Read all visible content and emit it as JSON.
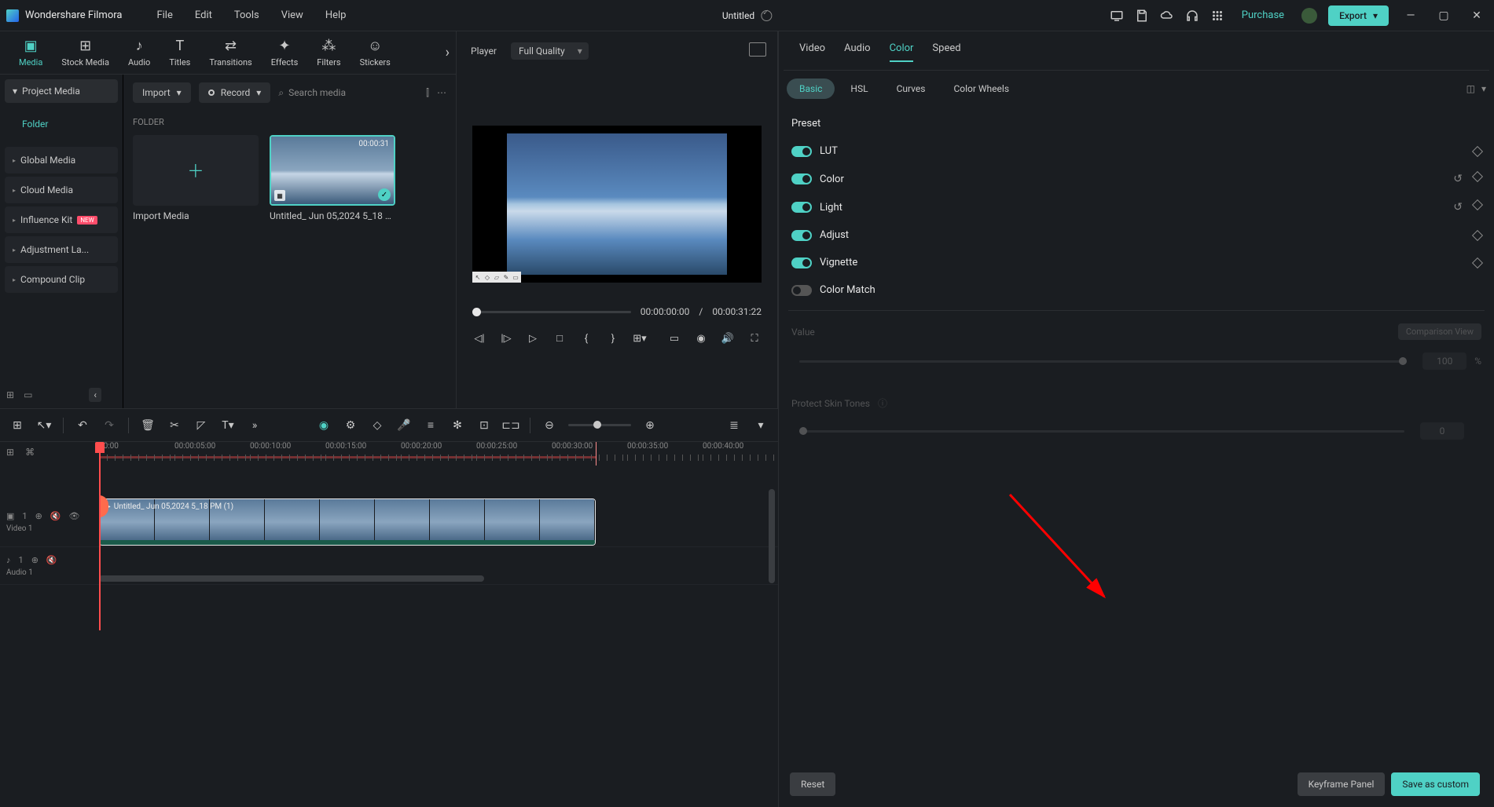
{
  "app": {
    "name": "Wondershare Filmora",
    "title": "Untitled"
  },
  "menu": [
    "File",
    "Edit",
    "Tools",
    "View",
    "Help"
  ],
  "titlebar": {
    "purchase": "Purchase",
    "export": "Export"
  },
  "toolbar_tabs": [
    {
      "id": "media",
      "label": "Media",
      "icon": "▣"
    },
    {
      "id": "stock",
      "label": "Stock Media",
      "icon": "⊞"
    },
    {
      "id": "audio",
      "label": "Audio",
      "icon": "♪"
    },
    {
      "id": "titles",
      "label": "Titles",
      "icon": "T"
    },
    {
      "id": "transitions",
      "label": "Transitions",
      "icon": "⇄"
    },
    {
      "id": "effects",
      "label": "Effects",
      "icon": "✦"
    },
    {
      "id": "filters",
      "label": "Filters",
      "icon": "⁂"
    },
    {
      "id": "stickers",
      "label": "Stickers",
      "icon": "☺"
    }
  ],
  "media_sidebar": {
    "head": "Project Media",
    "folder": "Folder",
    "items": [
      {
        "label": "Global Media"
      },
      {
        "label": "Cloud Media"
      },
      {
        "label": "Influence Kit",
        "badge": "NEW"
      },
      {
        "label": "Adjustment La..."
      },
      {
        "label": "Compound Clip"
      }
    ]
  },
  "media_main": {
    "import": "Import",
    "record": "Record",
    "search_placeholder": "Search media",
    "folder_label": "FOLDER",
    "import_card": "Import Media",
    "clip": {
      "duration": "00:00:31",
      "name": "Untitled_ Jun 05,2024 5_18 P..."
    }
  },
  "player": {
    "label": "Player",
    "quality": "Full Quality",
    "current": "00:00:00:00",
    "sep": "/",
    "total": "00:00:31:22"
  },
  "inspector": {
    "tabs": [
      "Video",
      "Audio",
      "Color",
      "Speed"
    ],
    "active_tab": "Color",
    "subtabs": [
      "Basic",
      "HSL",
      "Curves",
      "Color Wheels"
    ],
    "active_subtab": "Basic",
    "preset_title": "Preset",
    "rows": [
      {
        "label": "LUT",
        "reset": false
      },
      {
        "label": "Color",
        "reset": true
      },
      {
        "label": "Light",
        "reset": true
      },
      {
        "label": "Adjust",
        "reset": false
      },
      {
        "label": "Vignette",
        "reset": false
      }
    ],
    "color_match": "Color Match",
    "value_label": "Value",
    "comparison": "Comparison View",
    "value_num": "100",
    "value_unit": "%",
    "protect": "Protect Skin Tones",
    "protect_num": "0",
    "footer": {
      "reset": "Reset",
      "keyframe": "Keyframe Panel",
      "save": "Save as custom"
    }
  },
  "timeline": {
    "ticks": [
      "00:00",
      "00:00:05:00",
      "00:00:10:00",
      "00:00:15:00",
      "00:00:20:00",
      "00:00:25:00",
      "00:00:30:00",
      "00:00:35:00",
      "00:00:40:00"
    ],
    "video_track": {
      "num": "1",
      "label": "Video 1",
      "clip_name": "Untitled_ Jun 05,2024 5_18 PM (1)"
    },
    "audio_track": {
      "num": "1",
      "label": "Audio 1"
    }
  }
}
